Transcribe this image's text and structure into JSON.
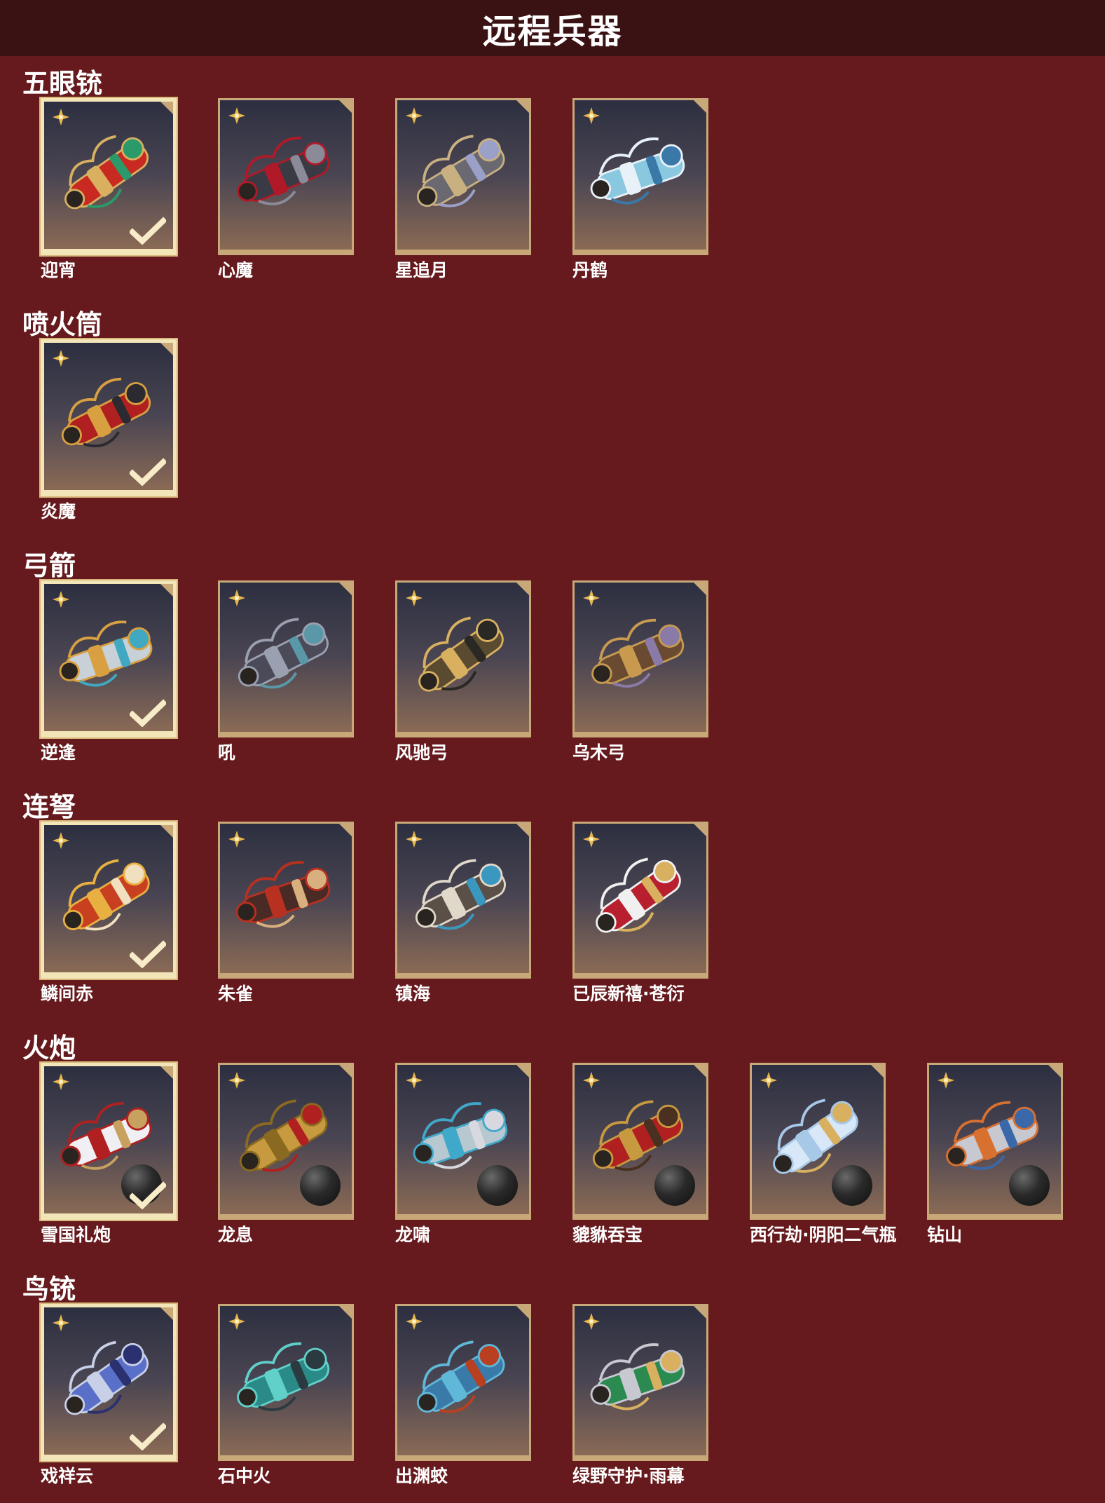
{
  "header": {
    "title": "远程兵器"
  },
  "sections": [
    {
      "title": "五眼铳",
      "items": [
        {
          "name": "迎宵",
          "selected": true,
          "has_ball": false,
          "palette": [
            "#c82a22",
            "#d8b060",
            "#2a9a6a"
          ]
        },
        {
          "name": "心魔",
          "selected": false,
          "has_ball": false,
          "palette": [
            "#3a3a44",
            "#b01a28",
            "#8a8a98"
          ]
        },
        {
          "name": "星追月",
          "selected": false,
          "has_ball": false,
          "palette": [
            "#6a6870",
            "#c8b080",
            "#9aa0c8"
          ]
        },
        {
          "name": "丹鹤",
          "selected": false,
          "has_ball": false,
          "palette": [
            "#8ac8e0",
            "#e8f0f8",
            "#3a78a8"
          ]
        }
      ]
    },
    {
      "title": "喷火筒",
      "items": [
        {
          "name": "炎魔",
          "selected": true,
          "has_ball": false,
          "palette": [
            "#b02020",
            "#d8a040",
            "#2a2a30"
          ]
        }
      ]
    },
    {
      "title": "弓箭",
      "items": [
        {
          "name": "逆逢",
          "selected": true,
          "has_ball": false,
          "palette": [
            "#c8d0d8",
            "#d8a040",
            "#40a8c0"
          ]
        },
        {
          "name": "吼",
          "selected": false,
          "has_ball": false,
          "palette": [
            "#4a4a58",
            "#9aa0b0",
            "#5a98a8"
          ]
        },
        {
          "name": "风驰弓",
          "selected": false,
          "has_ball": false,
          "palette": [
            "#5a4a30",
            "#d8b060",
            "#2a2824"
          ]
        },
        {
          "name": "乌木弓",
          "selected": false,
          "has_ball": false,
          "palette": [
            "#6a4a30",
            "#c89a50",
            "#8a7aa8"
          ]
        }
      ]
    },
    {
      "title": "连弩",
      "items": [
        {
          "name": "鳞间赤",
          "selected": true,
          "has_ball": false,
          "palette": [
            "#c84020",
            "#e8b040",
            "#f0e0c0"
          ]
        },
        {
          "name": "朱雀",
          "selected": false,
          "has_ball": false,
          "palette": [
            "#4a2a24",
            "#b83020",
            "#d8b080"
          ]
        },
        {
          "name": "镇海",
          "selected": false,
          "has_ball": false,
          "palette": [
            "#5a5048",
            "#e0d8c8",
            "#3a98c0"
          ]
        },
        {
          "name": "已辰新禧·苍衍",
          "selected": false,
          "has_ball": false,
          "palette": [
            "#b82030",
            "#f0f0f0",
            "#d8b060"
          ]
        }
      ]
    },
    {
      "title": "火炮",
      "items": [
        {
          "name": "雪国礼炮",
          "selected": true,
          "has_ball": true,
          "palette": [
            "#f0f0f4",
            "#b02020",
            "#c8a060"
          ]
        },
        {
          "name": "龙息",
          "selected": false,
          "has_ball": true,
          "palette": [
            "#c89a40",
            "#8a6a20",
            "#b02020"
          ]
        },
        {
          "name": "龙啸",
          "selected": false,
          "has_ball": true,
          "palette": [
            "#b8c8d0",
            "#40a8c8",
            "#d8d8e0"
          ]
        },
        {
          "name": "貔貅吞宝",
          "selected": false,
          "has_ball": true,
          "palette": [
            "#b02020",
            "#c89a40",
            "#4a3020"
          ]
        },
        {
          "name": "西行劫·阴阳二气瓶",
          "selected": false,
          "has_ball": true,
          "palette": [
            "#d8e8f8",
            "#a8c8e8",
            "#d8b060"
          ]
        },
        {
          "name": "钻山",
          "selected": false,
          "has_ball": true,
          "palette": [
            "#c8c8d0",
            "#d87030",
            "#3a68a8"
          ]
        }
      ]
    },
    {
      "title": "鸟铳",
      "items": [
        {
          "name": "戏祥云",
          "selected": true,
          "has_ball": false,
          "palette": [
            "#5a70c8",
            "#c8d0e8",
            "#2a3070"
          ]
        },
        {
          "name": "石中火",
          "selected": false,
          "has_ball": false,
          "palette": [
            "#2a8a88",
            "#60d0c8",
            "#2a3a40"
          ]
        },
        {
          "name": "出渊蛟",
          "selected": false,
          "has_ball": false,
          "palette": [
            "#3a7aa8",
            "#60b8d8",
            "#b84020"
          ]
        },
        {
          "name": "绿野守护·雨幕",
          "selected": false,
          "has_ball": false,
          "palette": [
            "#2a8a50",
            "#c8c8d0",
            "#d8b060"
          ]
        }
      ]
    }
  ]
}
